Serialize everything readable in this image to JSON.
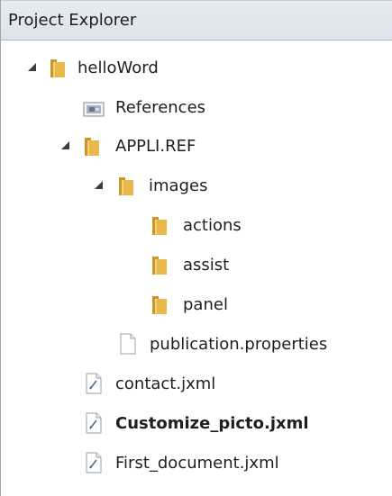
{
  "panel": {
    "title": "Project Explorer"
  },
  "tree": {
    "root": {
      "label": "helloWord",
      "expanded": true
    },
    "references": {
      "label": "References"
    },
    "appli_ref": {
      "label": "APPLI.REF",
      "expanded": true
    },
    "images": {
      "label": "images",
      "expanded": true
    },
    "actions": {
      "label": "actions"
    },
    "assist": {
      "label": "assist"
    },
    "panel_folder": {
      "label": "panel"
    },
    "publication": {
      "label": "publication.properties"
    },
    "contact": {
      "label": "contact.jxml"
    },
    "customize": {
      "label": "Customize_picto.jxml",
      "bold": true
    },
    "first_document": {
      "label": "First_document.jxml"
    }
  },
  "colors": {
    "folder": "#e8b84a",
    "folder_dark": "#c9962a",
    "title_bg": "#e2e7ef",
    "expander": "#3c3c3c"
  }
}
